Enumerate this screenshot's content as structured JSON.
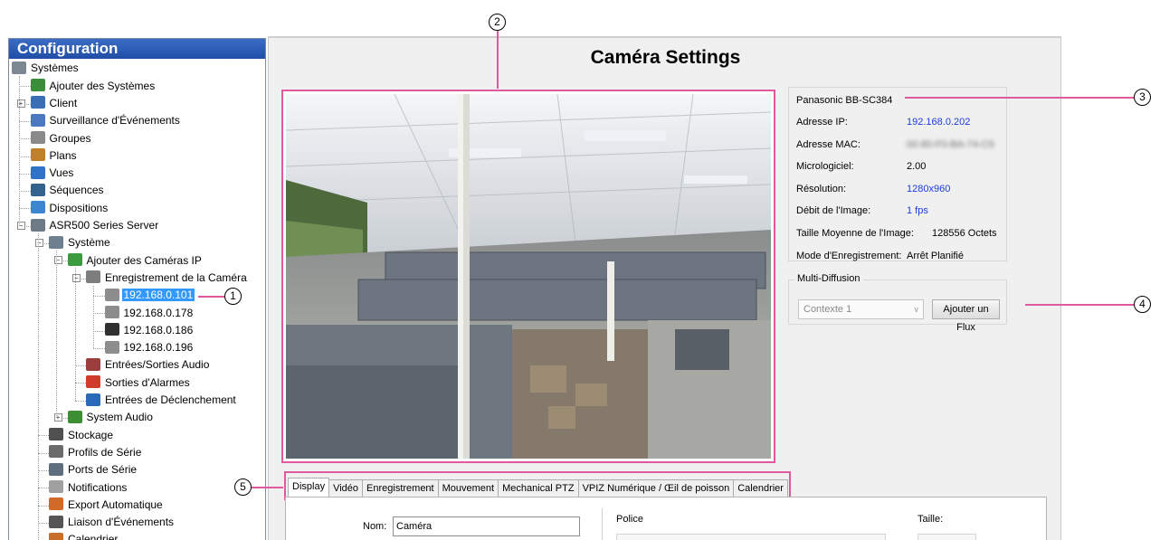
{
  "left_panel": {
    "title": "Configuration",
    "tree": [
      {
        "label": "Systèmes",
        "icon": "server-rack-icon",
        "level": 0,
        "expanded": true
      },
      {
        "label": "Ajouter des Systèmes",
        "icon": "add-system-icon",
        "level": 1
      },
      {
        "label": "Client",
        "icon": "client-gear-icon",
        "level": 1,
        "collapsed": true
      },
      {
        "label": "Surveillance d'Événements",
        "icon": "event-monitor-icon",
        "level": 1
      },
      {
        "label": "Groupes",
        "icon": "groups-icon",
        "level": 1
      },
      {
        "label": "Plans",
        "icon": "map-plan-icon",
        "level": 1
      },
      {
        "label": "Vues",
        "icon": "views-grid-icon",
        "level": 1
      },
      {
        "label": "Séquences",
        "icon": "sequence-icon",
        "level": 1
      },
      {
        "label": "Dispositions",
        "icon": "layout-icon",
        "level": 1
      },
      {
        "label": "ASR500 Series Server",
        "icon": "server-icon",
        "level": 1,
        "expanded": true
      },
      {
        "label": "Système",
        "icon": "system-icon",
        "level": 2,
        "expanded": true
      },
      {
        "label": "Ajouter des Caméras IP",
        "icon": "add-ip-camera-icon",
        "level": 3,
        "expanded": true
      },
      {
        "label": "Enregistrement de la Caméra",
        "icon": "camera-recording-icon",
        "level": 4,
        "expanded": true
      },
      {
        "label": "192.168.0.101",
        "icon": "network-camera-icon",
        "level": 5,
        "selected": true
      },
      {
        "label": "192.168.0.178",
        "icon": "network-camera-icon",
        "level": 5
      },
      {
        "label": "192.168.0.186",
        "icon": "dome-camera-icon",
        "level": 5
      },
      {
        "label": "192.168.0.196",
        "icon": "network-camera-icon",
        "level": 5
      },
      {
        "label": "Entrées/Sorties Audio",
        "icon": "speaker-icon",
        "level": 4
      },
      {
        "label": "Sorties d'Alarmes",
        "icon": "alarm-output-icon",
        "level": 4
      },
      {
        "label": "Entrées de Déclenchement",
        "icon": "trigger-input-icon",
        "level": 4
      },
      {
        "label": "System Audio",
        "icon": "audio-card-icon",
        "level": 3,
        "collapsed": true
      },
      {
        "label": "Stockage",
        "icon": "storage-icon",
        "level": 2
      },
      {
        "label": "Profils de Série",
        "icon": "serial-profile-icon",
        "level": 2
      },
      {
        "label": "Ports de Série",
        "icon": "serial-port-icon",
        "level": 2
      },
      {
        "label": "Notifications",
        "icon": "envelope-icon",
        "level": 2
      },
      {
        "label": "Export Automatique",
        "icon": "auto-export-icon",
        "level": 2
      },
      {
        "label": "Liaison d'Événements",
        "icon": "event-link-icon",
        "level": 2
      },
      {
        "label": "Calendrier",
        "icon": "calendar-icon",
        "level": 2
      }
    ]
  },
  "main": {
    "title": "Caméra Settings",
    "camera_info": {
      "model": "Panasonic BB-SC384",
      "rows": [
        {
          "label": "Adresse IP:",
          "value": "192.168.0.202",
          "blue": true
        },
        {
          "label": "Adresse MAC:",
          "value": "00-80-F0-BA-74-C9",
          "blurred": true
        },
        {
          "label": "Micrologiciel:",
          "value": "2.00"
        },
        {
          "label": "Résolution:",
          "value": "1280x960",
          "blue": true
        },
        {
          "label": "Débit de l'Image:",
          "value": "1 fps",
          "blue": true
        },
        {
          "label": "Taille Moyenne de l'Image:",
          "value": "128556 Octets"
        },
        {
          "label": "Mode d'Enregistrement:",
          "value": "Arrêt Planifié"
        }
      ]
    },
    "multicast": {
      "title": "Multi-Diffusion",
      "select_value": "Contexte 1",
      "add_button": "Ajouter un Flux"
    },
    "tabs": [
      {
        "label": "Display",
        "active": true
      },
      {
        "label": "Vidéo"
      },
      {
        "label": "Enregistrement"
      },
      {
        "label": "Mouvement"
      },
      {
        "label": "Mechanical PTZ"
      },
      {
        "label": "VPIZ Numérique / Œil de poisson"
      },
      {
        "label": "Calendrier"
      }
    ],
    "display_tab": {
      "name_label": "Nom:",
      "name_value": "Caméra",
      "font_label": "Police",
      "size_label": "Taille:"
    }
  },
  "callouts": {
    "c1": "1",
    "c2": "2",
    "c3": "3",
    "c4": "4",
    "c5": "5"
  },
  "colors": {
    "accent": "#e2589e",
    "header_blue": "#1f4ea6",
    "selection": "#3399ff",
    "link_blue": "#1b3cd9"
  }
}
